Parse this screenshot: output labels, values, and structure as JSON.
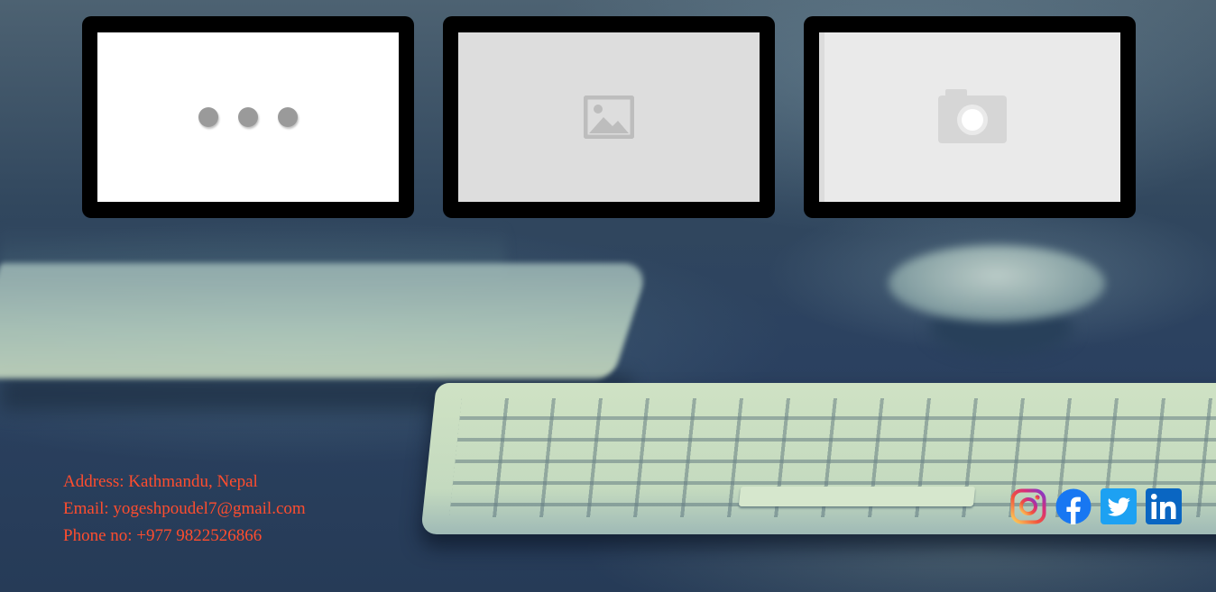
{
  "thumbnails": [
    {
      "state": "loading",
      "icon": "loading-dots-icon"
    },
    {
      "state": "image-placeholder",
      "icon": "image-icon"
    },
    {
      "state": "photo-placeholder",
      "icon": "camera-icon"
    }
  ],
  "contact": {
    "address": "Address: Kathmandu, Nepal",
    "email": "Email: yogeshpoudel7@gmail.com",
    "phone": "Phone no: +977 9822526866"
  },
  "social": {
    "instagram": {
      "icon": "instagram-icon",
      "color": "#e1306c"
    },
    "facebook": {
      "icon": "facebook-icon",
      "color": "#1877f2"
    },
    "twitter": {
      "icon": "twitter-icon",
      "color": "#1da1f2"
    },
    "linkedin": {
      "icon": "linkedin-icon",
      "color": "#0a66c2"
    }
  },
  "colors": {
    "contact_text": "#ff4d2e",
    "card_frame": "#000000"
  }
}
